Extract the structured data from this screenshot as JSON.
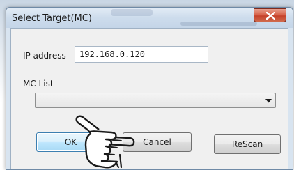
{
  "dialog": {
    "title": "Select Target(MC)",
    "close_label": "X"
  },
  "form": {
    "ip_label": "IP address",
    "ip_value": "192.168.0.120",
    "mc_list_label": "MC List",
    "mc_list_selected": ""
  },
  "buttons": {
    "ok": "OK",
    "cancel": "Cancel",
    "rescan": "ReScan"
  },
  "colors": {
    "close_button": "#c5412a",
    "default_button_border": "#3c7fb1",
    "window_frame": "#d8e4f0"
  },
  "icons": {
    "close": "close-icon",
    "dropdown": "chevron-down-icon",
    "pointer": "pointing-hand-icon"
  }
}
